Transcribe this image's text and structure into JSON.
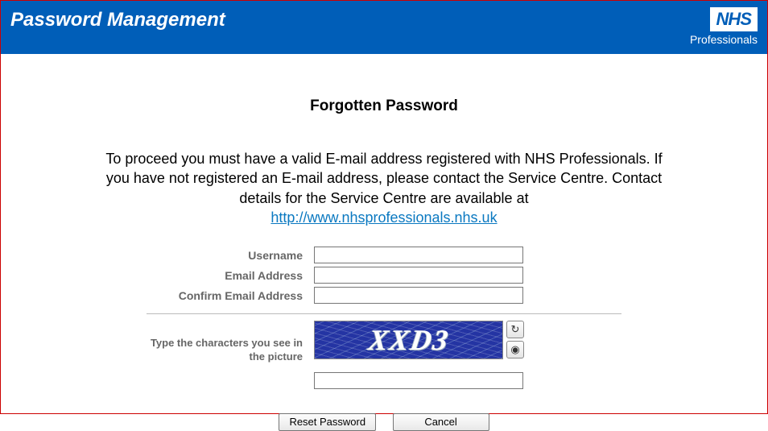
{
  "header": {
    "title": "Password Management",
    "logo_text": "NHS",
    "logo_sub": "Professionals"
  },
  "page": {
    "heading": "Forgotten Password",
    "intro_text": "To proceed you must have a valid E-mail address registered with NHS Professionals. If you have not registered an E-mail address, please contact the Service Centre. Contact details for the Service Centre are available at",
    "intro_link_text": "http://www.nhsprofessionals.nhs.uk"
  },
  "form": {
    "username_label": "Username",
    "username_value": "",
    "email_label": "Email Address",
    "email_value": "",
    "confirm_email_label": "Confirm Email Address",
    "confirm_email_value": "",
    "captcha_label": "Type the characters you see in the picture",
    "captcha_image_text": "XXD3",
    "captcha_value": ""
  },
  "buttons": {
    "reset_label": "Reset Password",
    "cancel_label": "Cancel"
  }
}
